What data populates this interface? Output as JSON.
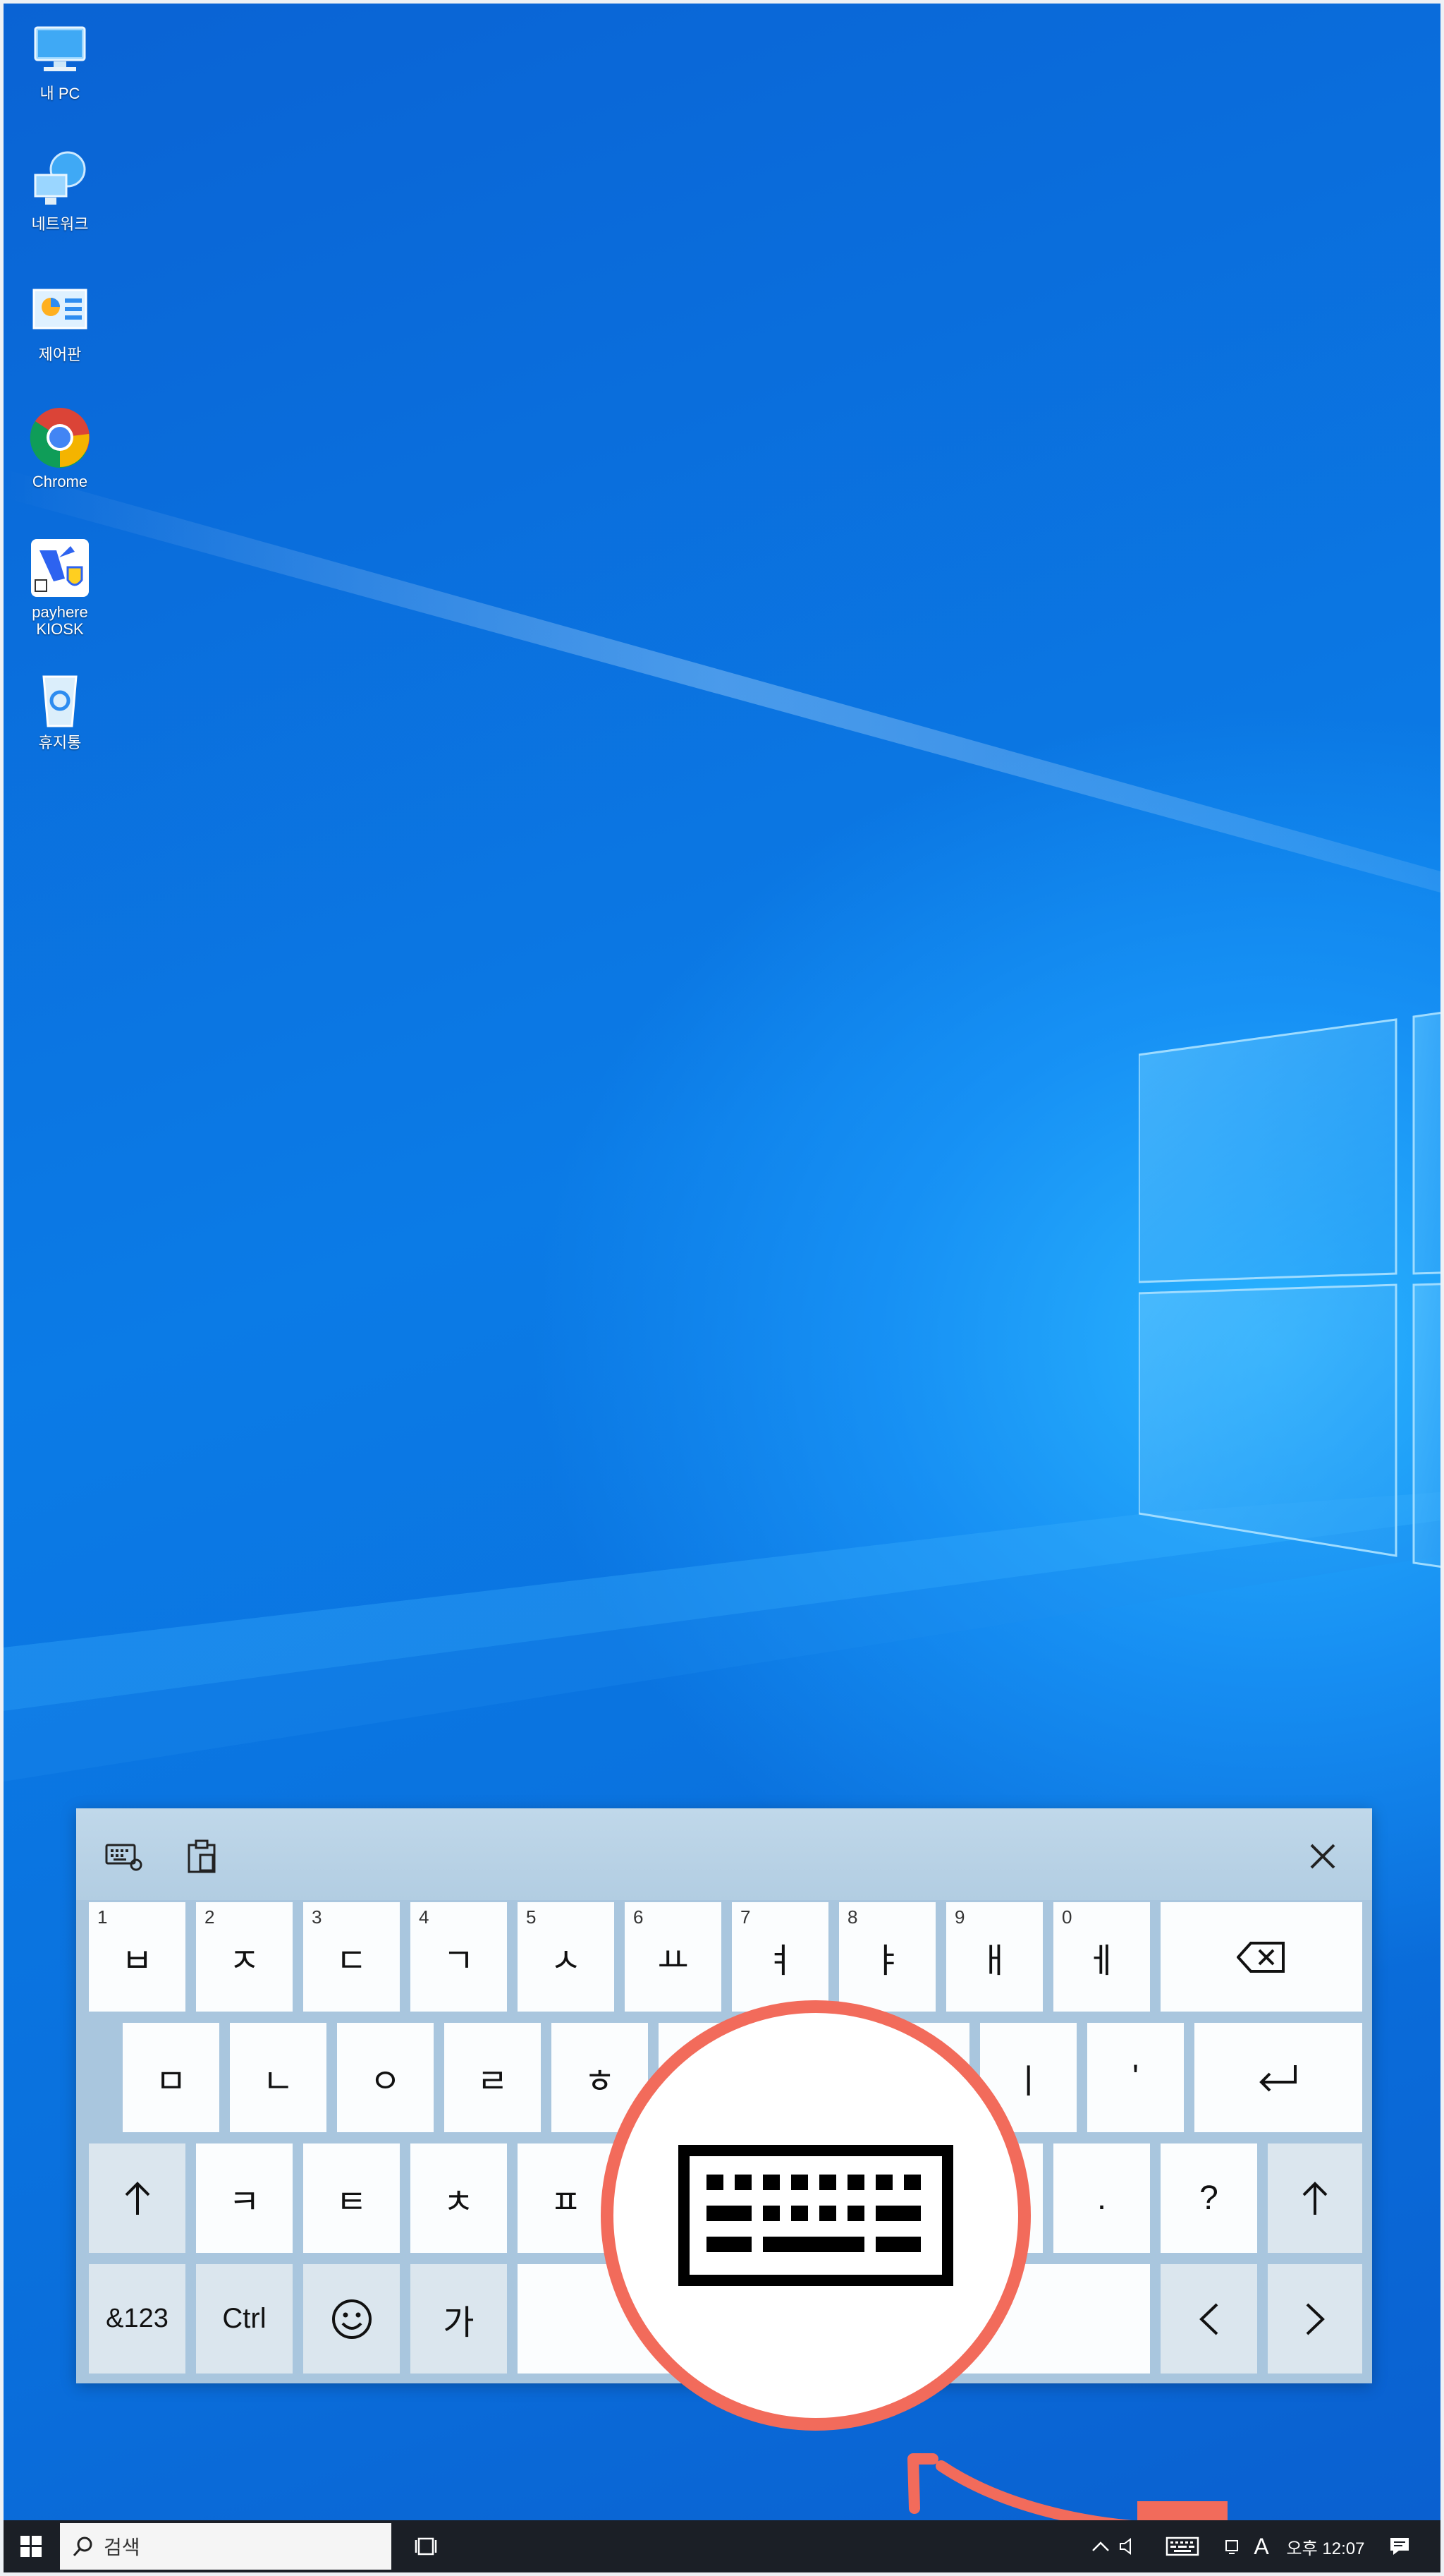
{
  "desktop": {
    "icons": [
      {
        "label": "내 PC",
        "icon": "this-pc-icon"
      },
      {
        "label": "네트워크",
        "icon": "network-icon"
      },
      {
        "label": "제어판",
        "icon": "control-panel-icon"
      },
      {
        "label": "Chrome",
        "icon": "chrome-icon"
      },
      {
        "label": "payhere\nKIOSK",
        "icon": "payhere-kiosk-icon"
      },
      {
        "label": "휴지통",
        "icon": "recycle-bin-icon"
      }
    ]
  },
  "keyboard": {
    "toolbar": {
      "settings_icon": "keyboard-settings-icon",
      "clipboard_icon": "clipboard-icon",
      "close_icon": "close-icon"
    },
    "row1": [
      {
        "num": "1",
        "label": "ㅂ"
      },
      {
        "num": "2",
        "label": "ㅈ"
      },
      {
        "num": "3",
        "label": "ㄷ"
      },
      {
        "num": "4",
        "label": "ㄱ"
      },
      {
        "num": "5",
        "label": "ㅅ"
      },
      {
        "num": "6",
        "label": "ㅛ"
      },
      {
        "num": "7",
        "label": "ㅕ"
      },
      {
        "num": "8",
        "label": "ㅑ"
      },
      {
        "num": "9",
        "label": "ㅐ"
      },
      {
        "num": "0",
        "label": "ㅔ"
      }
    ],
    "row2": [
      "ㅁ",
      "ㄴ",
      "ㅇ",
      "ㄹ",
      "ㅎ",
      "ㅣ",
      "'"
    ],
    "row3": [
      "ㅋ",
      "ㅌ",
      "ㅊ",
      "ㅍ",
      ".",
      "?"
    ],
    "row4": {
      "symbols": "&123",
      "ctrl": "Ctrl",
      "lang": "가"
    },
    "colors": {
      "key": "#fbfdfe",
      "dark_key": "#dbe6ee",
      "frame": "#a9c6de"
    }
  },
  "callout": {
    "icon": "touch-keyboard-icon",
    "color": "#f26b5b"
  },
  "taskbar": {
    "search_placeholder": "검색",
    "ime_mode": "A",
    "clock": "오후 12:07",
    "icons": [
      "start-icon",
      "search-icon",
      "task-view-icon",
      "chevron-up-icon",
      "volume-icon",
      "touch-keyboard-icon",
      "network-icon",
      "notification-icon"
    ]
  }
}
